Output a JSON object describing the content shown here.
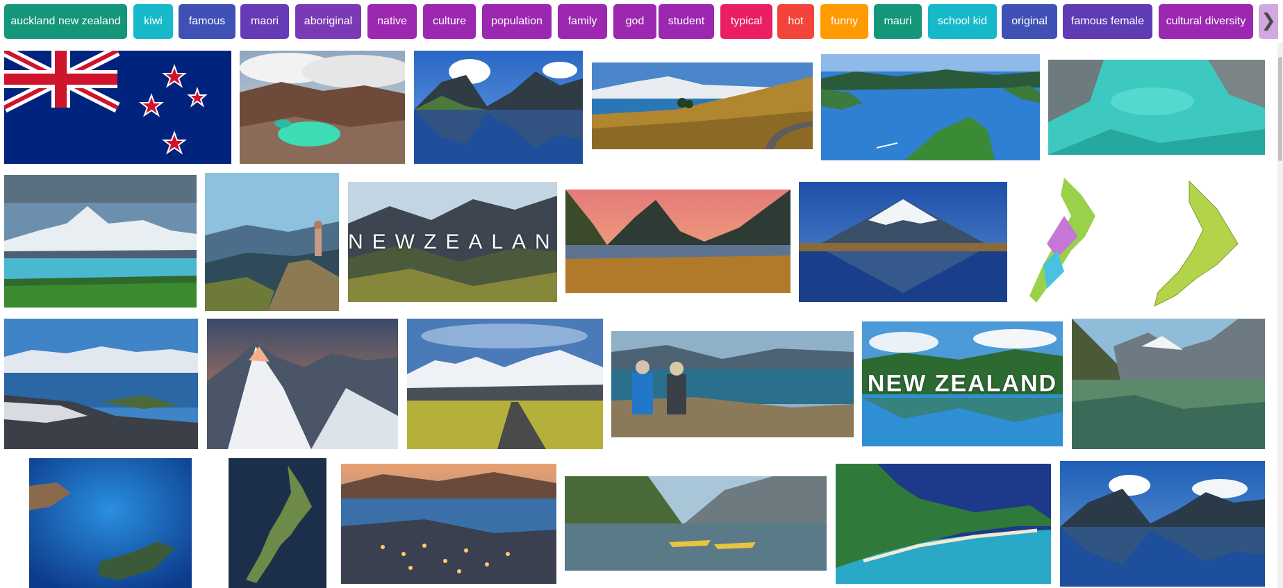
{
  "chips": [
    {
      "label": "auckland new zealand",
      "color": "#14967b"
    },
    {
      "label": "kiwi",
      "color": "#16b9c9"
    },
    {
      "label": "famous",
      "color": "#3f51b5"
    },
    {
      "label": "maori",
      "color": "#673ab7"
    },
    {
      "label": "aboriginal",
      "color": "#7b3ab5"
    },
    {
      "label": "native",
      "color": "#9c27b0"
    },
    {
      "label": "culture",
      "color": "#9c27b0"
    },
    {
      "label": "population",
      "color": "#9c27b0"
    },
    {
      "label": "family",
      "color": "#9c27b0"
    },
    {
      "label": "god",
      "color": "#9c27b0"
    },
    {
      "label": "student",
      "color": "#9c27b0"
    },
    {
      "label": "typical",
      "color": "#e91e63"
    },
    {
      "label": "hot",
      "color": "#f4433a"
    },
    {
      "label": "funny",
      "color": "#ff9a00"
    },
    {
      "label": "mauri",
      "color": "#14967b"
    },
    {
      "label": "school kid",
      "color": "#16b9c9"
    },
    {
      "label": "original",
      "color": "#3f51b5"
    },
    {
      "label": "famous female",
      "color": "#5f3bb4"
    },
    {
      "label": "cultural diversity",
      "color": "#9c27b0"
    }
  ],
  "chip_arrow": {
    "icon": "chevron-right-icon",
    "glyph": "❯"
  },
  "tiles": [
    {
      "name": "image-tile-nz-flag",
      "overlay": ""
    },
    {
      "name": "image-tile-emerald-lakes",
      "overlay": ""
    },
    {
      "name": "image-tile-milford-sound",
      "overlay": ""
    },
    {
      "name": "image-tile-mountain-road",
      "overlay": ""
    },
    {
      "name": "image-tile-marlborough-sounds",
      "overlay": ""
    },
    {
      "name": "image-tile-turquoise-river",
      "overlay": ""
    },
    {
      "name": "image-tile-mount-cook",
      "overlay": ""
    },
    {
      "name": "image-tile-yoga-peak",
      "overlay": ""
    },
    {
      "name": "image-tile-newzealand-text",
      "overlay": "NEWZEALAND"
    },
    {
      "name": "image-tile-sunset-peak",
      "overlay": ""
    },
    {
      "name": "image-tile-mount-taranaki",
      "overlay": ""
    },
    {
      "name": "image-tile-nz-maps",
      "overlay": ""
    },
    {
      "name": "image-tile-queenstown",
      "overlay": ""
    },
    {
      "name": "image-tile-snowy-peak",
      "overlay": ""
    },
    {
      "name": "image-tile-road-mountains",
      "overlay": ""
    },
    {
      "name": "image-tile-hikers",
      "overlay": ""
    },
    {
      "name": "image-tile-new-zealand-text",
      "overlay": "NEW ZEALAND"
    },
    {
      "name": "image-tile-lake-marian",
      "overlay": ""
    },
    {
      "name": "image-tile-globe",
      "overlay": ""
    },
    {
      "name": "image-tile-satellite-nz",
      "overlay": ""
    },
    {
      "name": "image-tile-queenstown-night",
      "overlay": ""
    },
    {
      "name": "image-tile-kayaks",
      "overlay": ""
    },
    {
      "name": "image-tile-coastline",
      "overlay": ""
    },
    {
      "name": "image-tile-milford-reflection",
      "overlay": ""
    }
  ]
}
